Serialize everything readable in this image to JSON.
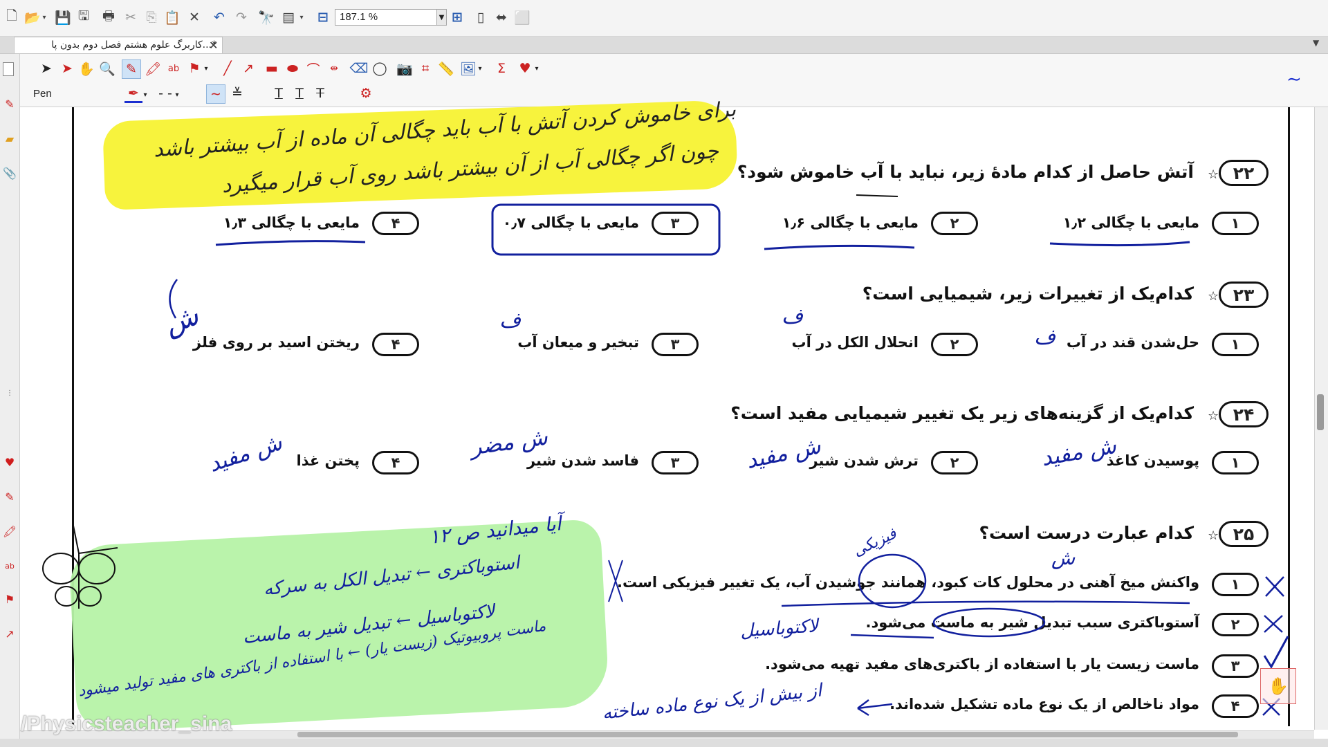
{
  "toolbar": {
    "zoom_value": "187.1 %"
  },
  "tabs": {
    "active_title": "*...کاربرگ علوم هشتم فصل دوم بدون پا",
    "close_glyph": "✕"
  },
  "annot_toolbar": {
    "tool_label": "Pen"
  },
  "questions": [
    {
      "number": "۲۲",
      "text": "آتش حاصل از کدام مادهٔ زیر، نباید با آب خاموش شود؟",
      "options": [
        {
          "n": "۱",
          "text": "مایعی با چگالی ۱٫۲"
        },
        {
          "n": "۲",
          "text": "مایعی با چگالی ۱٫۶"
        },
        {
          "n": "۳",
          "text": "مایعی با چگالی ۰٫۷"
        },
        {
          "n": "۴",
          "text": "مایعی با چگالی ۱٫۳"
        }
      ]
    },
    {
      "number": "۲۳",
      "text": "کدام‌یک از تغییرات زیر، شیمیایی است؟",
      "options": [
        {
          "n": "۱",
          "text": "حل‌شدن قند در آب"
        },
        {
          "n": "۲",
          "text": "انحلال الکل در آب"
        },
        {
          "n": "۳",
          "text": "تبخیر و میعان آب"
        },
        {
          "n": "۴",
          "text": "ریختن اسید بر روی فلز"
        }
      ]
    },
    {
      "number": "۲۴",
      "text": "کدام‌یک از گزینه‌های زیر یک تغییر شیمیایی مفید است؟",
      "options": [
        {
          "n": "۱",
          "text": "پوسیدن کاغذ"
        },
        {
          "n": "۲",
          "text": "ترش شدن شیر"
        },
        {
          "n": "۳",
          "text": "فاسد شدن شیر"
        },
        {
          "n": "۴",
          "text": "پختن غذا"
        }
      ]
    },
    {
      "number": "۲۵",
      "text": "کدام عبارت درست است؟",
      "options": [
        {
          "n": "۱",
          "text": "واکنش میخ آهنی در محلول کات کبود، همانند جوشیدن آب، یک تغییر فیزیکی است."
        },
        {
          "n": "۲",
          "text": "آستوباکتری سبب تبدیل شیر به ماست می‌شود."
        },
        {
          "n": "۳",
          "text": "ماست زیست یار با استفاده از باکتری‌های مفید تهیه می‌شود."
        },
        {
          "n": "۴",
          "text": "مواد ناخالص از یک نوع ماده تشکیل شده‌اند."
        }
      ]
    }
  ],
  "handwriting": {
    "yellow_note_line1": "برای خاموش کردن آتش با آب باید چگالی آن ماده از آب بیشتر باشد",
    "yellow_note_line2": "چون اگر چگالی آب از آن بیشتر باشد روی آب قرار میگیرد",
    "q23_f1": "ف",
    "q23_f2": "ف",
    "q23_f3": "ف",
    "q23_s4": "ش",
    "q24_1": "ش مفید",
    "q24_2": "ش مفید",
    "q24_3": "ش مضر",
    "q24_4": "ش مفید",
    "q25_fizik": "فیزیکی",
    "q25_sh": "ش",
    "q25_lacto": "لاکتوباسیل",
    "q25_opt4": "از بیش از یک نوع ماده ساخته",
    "green_title": "آیا میدانید ص ۱۲",
    "green_l1": "استوباکتری ← تبدیل الکل به سرکه",
    "green_l2": "لاکتوباسیل ← تبدیل شیر به ماست",
    "green_l3": "ماست پروبیوتیک (زیست یار) ← با استفاده از باکتری های مفید تولید میشود"
  },
  "watermark": "/Physicsteacher_sina"
}
